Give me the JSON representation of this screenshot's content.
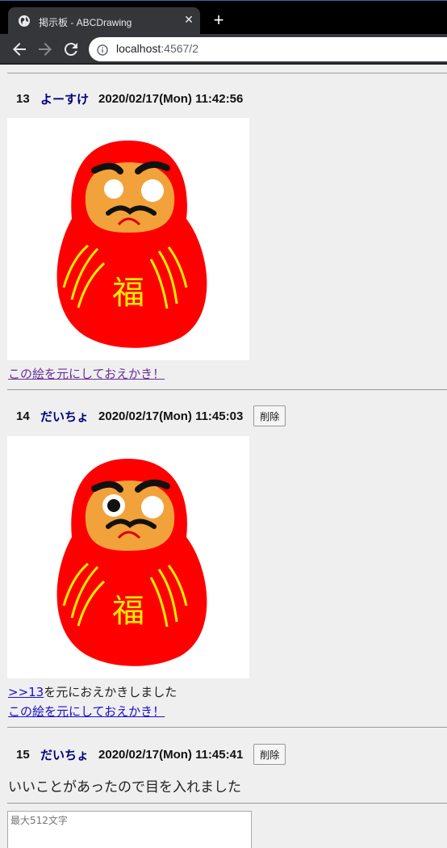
{
  "browser": {
    "tab_title": "掲示板 - ABCDrawing",
    "url_host": "localhost",
    "url_path": ":4567/2"
  },
  "posts": [
    {
      "number": "13",
      "name": "よーすけ",
      "date": "2020/02/17(Mon) 11:42:56",
      "remix_link": "この絵を元にしておえかき！"
    },
    {
      "number": "14",
      "name": "だいちょ",
      "date": "2020/02/17(Mon) 11:45:03",
      "delete_label": "削除",
      "ref_link": ">>13",
      "ref_text": "を元におえかきしました",
      "remix_link": "この絵を元にしておえかき！"
    },
    {
      "number": "15",
      "name": "だいちょ",
      "date": "2020/02/17(Mon) 11:45:41",
      "delete_label": "削除",
      "message": "いいことがあったので目を入れました"
    }
  ],
  "form": {
    "placeholder": "最大512文字"
  },
  "drawing_glyph": "福",
  "colors": {
    "daruma_body": "#ff0000",
    "daruma_face": "#f0a040",
    "gold": "#ffee00",
    "name_color": "#000080"
  }
}
